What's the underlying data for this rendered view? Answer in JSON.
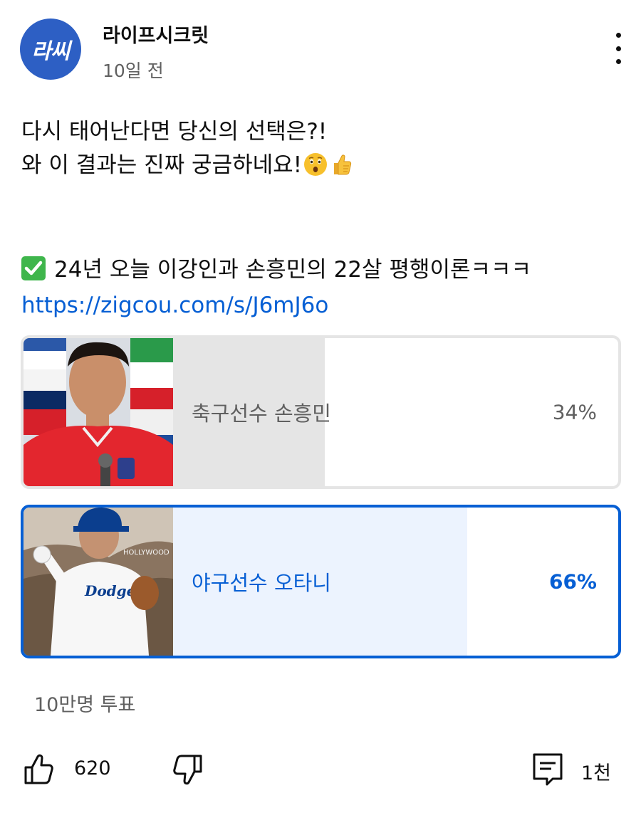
{
  "channel": {
    "avatar_text": "라씨",
    "name": "라이프시크릿",
    "time": "10일 전"
  },
  "post": {
    "line1": "다시 태어난다면 당신의 선택은?!",
    "line2": "와 이 결과는 진짜 궁금하네요!",
    "emojis": [
      "astonished-face",
      "thumbs-up"
    ],
    "link_text": "24년 오늘 이강인과 손흥민의 22살 평행이론ㅋㅋㅋ",
    "link_url": "https://zigcou.com/s/J6mJ6o"
  },
  "poll": {
    "options": [
      {
        "label": "축구선수 손흥민",
        "percent_text": "34%",
        "percent": 34,
        "selected": false
      },
      {
        "label": "야구선수 오타니",
        "percent_text": "66%",
        "percent": 66,
        "selected": true
      }
    ],
    "vote_count": "10만명 투표"
  },
  "actions": {
    "like_count": "620",
    "comment_count": "1천"
  },
  "colors": {
    "accent": "#065fd4",
    "avatar": "#2d5fc4",
    "text_secondary": "#606060",
    "poll_fill_unselected": "#e5e5e5",
    "poll_fill_selected": "#ecf3fe"
  }
}
